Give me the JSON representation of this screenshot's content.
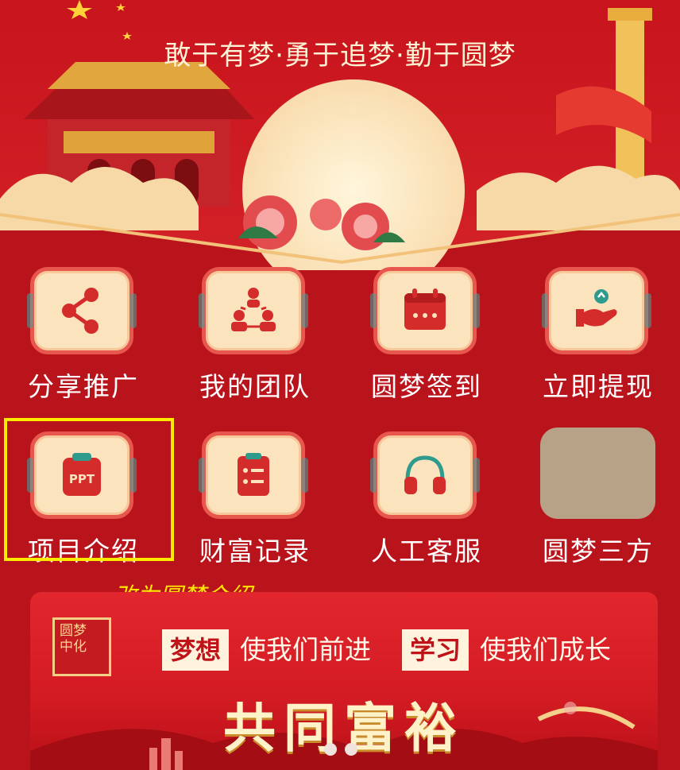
{
  "hero": {
    "slogan": "敢于有梦·勇于追梦·勤于圆梦"
  },
  "menu": {
    "items": [
      {
        "label": "分享推广",
        "icon": "share-icon"
      },
      {
        "label": "我的团队",
        "icon": "team-icon"
      },
      {
        "label": "圆梦签到",
        "icon": "calendar-icon"
      },
      {
        "label": "立即提现",
        "icon": "withdraw-icon"
      },
      {
        "label": "项目介绍",
        "icon": "ppt-icon"
      },
      {
        "label": "财富记录",
        "icon": "clipboard-icon"
      },
      {
        "label": "人工客服",
        "icon": "headset-icon"
      },
      {
        "label": "圆梦三方",
        "icon": "placeholder-tile"
      }
    ]
  },
  "annotation": {
    "text": "改为圆梦介绍",
    "color": "#ffe600"
  },
  "banner": {
    "logo_chars": [
      "圆梦",
      "中化"
    ],
    "tag1": "梦想",
    "text1": "使我们前进",
    "tag2": "学习",
    "text2": "使我们成长",
    "title": "共同富裕"
  },
  "colors": {
    "background": "#b9141b",
    "tile": "#fae3bd",
    "tile_border": "#e8574e",
    "icon_red": "#d42b2b",
    "highlight": "#ffea00"
  }
}
